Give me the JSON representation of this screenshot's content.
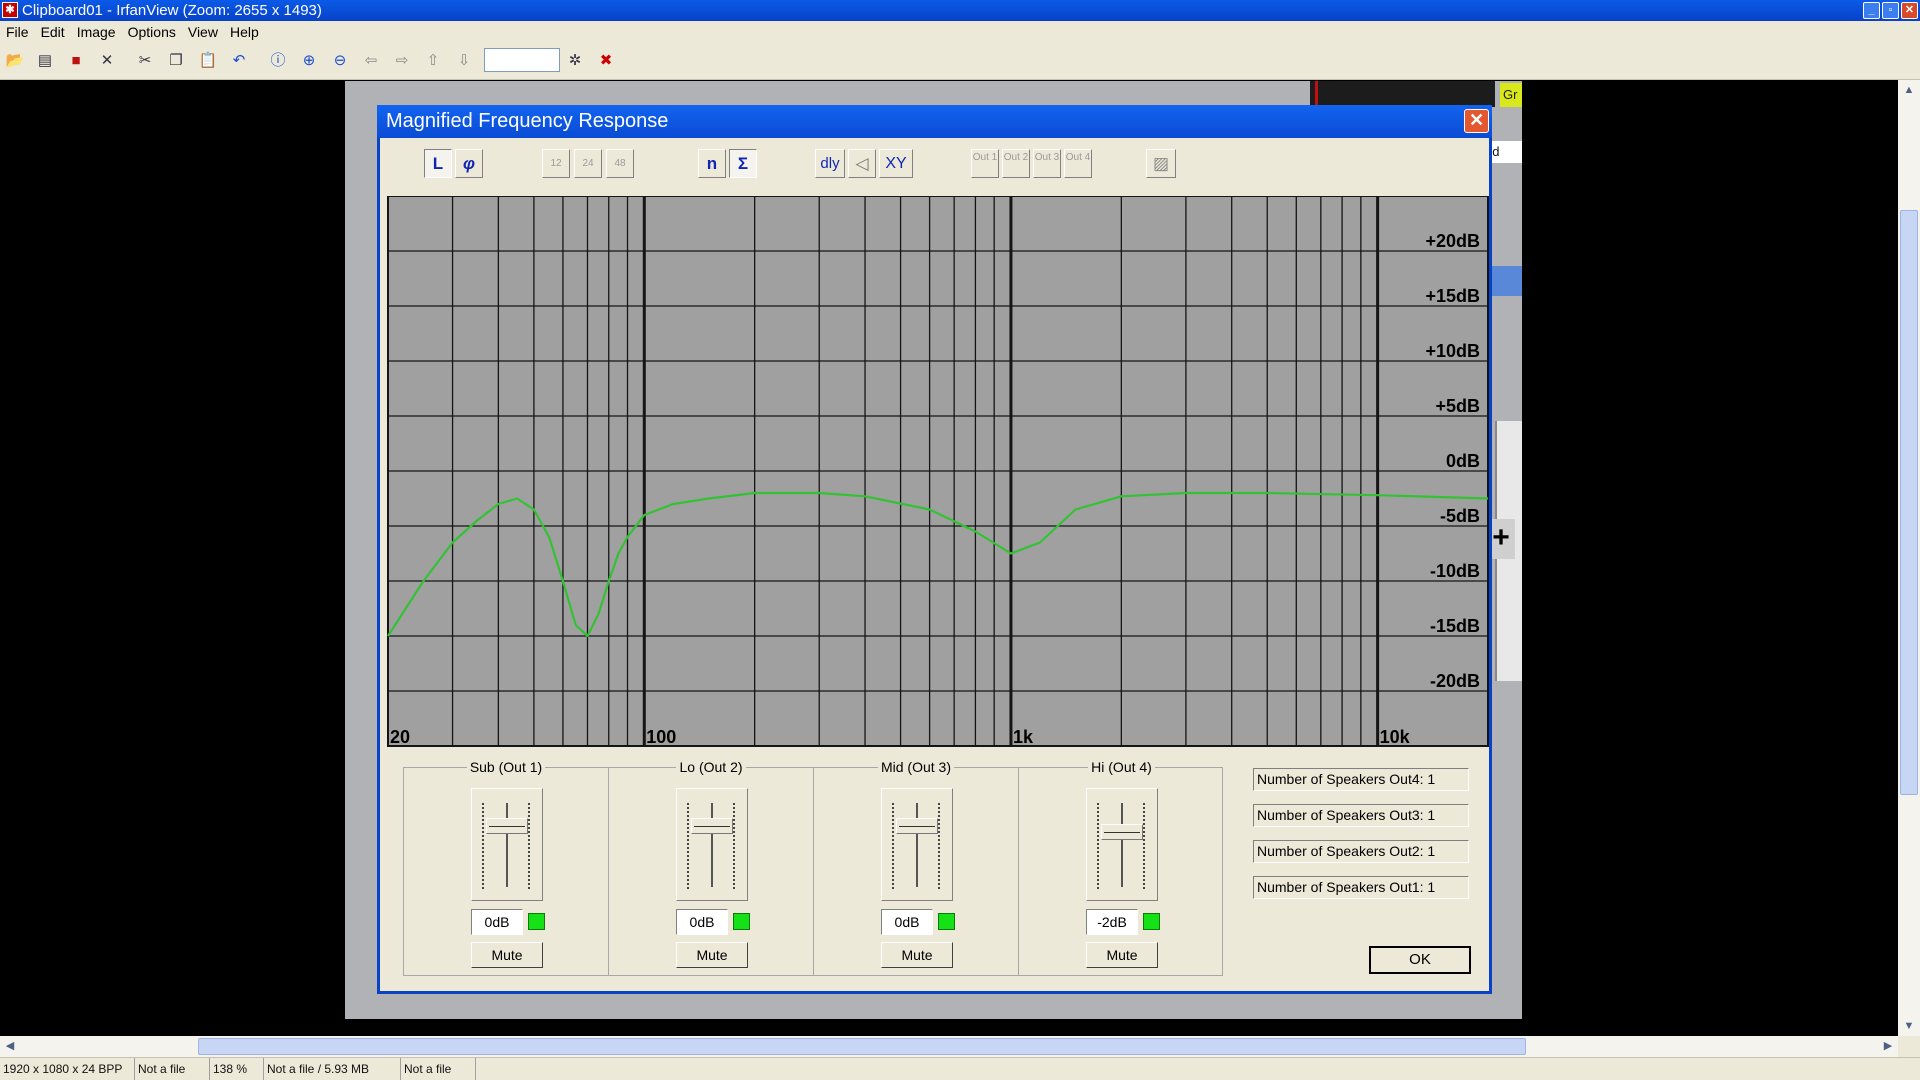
{
  "window": {
    "title": "Clipboard01 - IrfanView (Zoom: 2655 x 1493)",
    "app_icon": "irfanview-cat-icon"
  },
  "menu": [
    "File",
    "Edit",
    "Image",
    "Options",
    "View",
    "Help"
  ],
  "toolbar": {
    "icons": [
      "open-folder-icon",
      "thumbnails-icon",
      "save-icon",
      "delete-icon",
      "cut-icon",
      "copy-icon",
      "paste-icon",
      "undo-icon",
      "info-icon",
      "zoom-in-icon",
      "zoom-out-icon",
      "previous-icon",
      "next-icon",
      "first-page-icon",
      "last-page-icon",
      "settings-icon",
      "exit-icon"
    ],
    "page_field": ""
  },
  "dialog": {
    "title": "Magnified Frequency Response",
    "toolbar": {
      "linear": "L",
      "phase": "φ",
      "slope12": "12",
      "slope24": "24",
      "slope48": "48",
      "individual": "n",
      "sum": "Σ",
      "delay": "dly",
      "polarity": "◁",
      "xy": "XY",
      "out1": "Out 1",
      "out2": "Out 2",
      "out3": "Out 3",
      "out4": "Out 4"
    },
    "graph": {
      "y_labels": [
        "+20dB",
        "+15dB",
        "+10dB",
        "+5dB",
        "0dB",
        "-5dB",
        "-10dB",
        "-15dB",
        "-20dB"
      ],
      "x_labels": [
        "20",
        "100",
        "1k",
        "10k"
      ],
      "background": "#a0a0a0",
      "grid_color": "#151515",
      "curve_color": "#33c233"
    },
    "chart_data": {
      "type": "line",
      "x_scale": "log",
      "xlim": [
        20,
        20000
      ],
      "ylim": [
        -25,
        25
      ],
      "x_ticks": [
        "20",
        "100",
        "1k",
        "10k"
      ],
      "y_ticks": [
        "+20dB",
        "+15dB",
        "+10dB",
        "+5dB",
        "0dB",
        "-5dB",
        "-10dB",
        "-15dB",
        "-20dB"
      ],
      "series": [
        {
          "x": [
            20,
            25,
            30,
            35,
            40,
            45,
            50,
            55,
            60,
            65,
            70,
            75,
            80,
            85,
            90,
            100,
            120,
            150,
            200,
            300,
            400,
            600,
            800,
            1000,
            1200,
            1500,
            2000,
            3000,
            5000,
            10000,
            20000
          ],
          "y": [
            -15,
            -10,
            -6.5,
            -4.5,
            -3,
            -2.5,
            -3.5,
            -6,
            -10,
            -14,
            -15,
            -13,
            -10,
            -7.5,
            -6,
            -4,
            -3,
            -2.5,
            -2,
            -2,
            -2.3,
            -3.5,
            -5.5,
            -7.5,
            -6.5,
            -3.5,
            -2.3,
            -2,
            -2,
            -2.2,
            -2.5
          ]
        }
      ]
    },
    "faders": [
      {
        "label": "Sub (Out 1)",
        "value": "0dB",
        "mute": "Mute",
        "level": 0.22
      },
      {
        "label": "Lo (Out 2)",
        "value": "0dB",
        "mute": "Mute",
        "level": 0.22
      },
      {
        "label": "Mid (Out 3)",
        "value": "0dB",
        "mute": "Mute",
        "level": 0.22
      },
      {
        "label": "Hi (Out 4)",
        "value": "-2dB",
        "mute": "Mute",
        "level": 0.3
      }
    ],
    "speakers": [
      "Number of Speakers Out4: 1",
      "Number of Speakers Out3: 1",
      "Number of Speakers Out2: 1",
      "Number of Speakers Out1: 1"
    ],
    "ok": "OK"
  },
  "background": {
    "peek_label": "Gr",
    "peek_text": "ed"
  },
  "statusbar": [
    "1920 x 1080 x 24 BPP",
    "Not a file",
    "138 %",
    "Not a file / 5.93 MB",
    "Not a file"
  ]
}
